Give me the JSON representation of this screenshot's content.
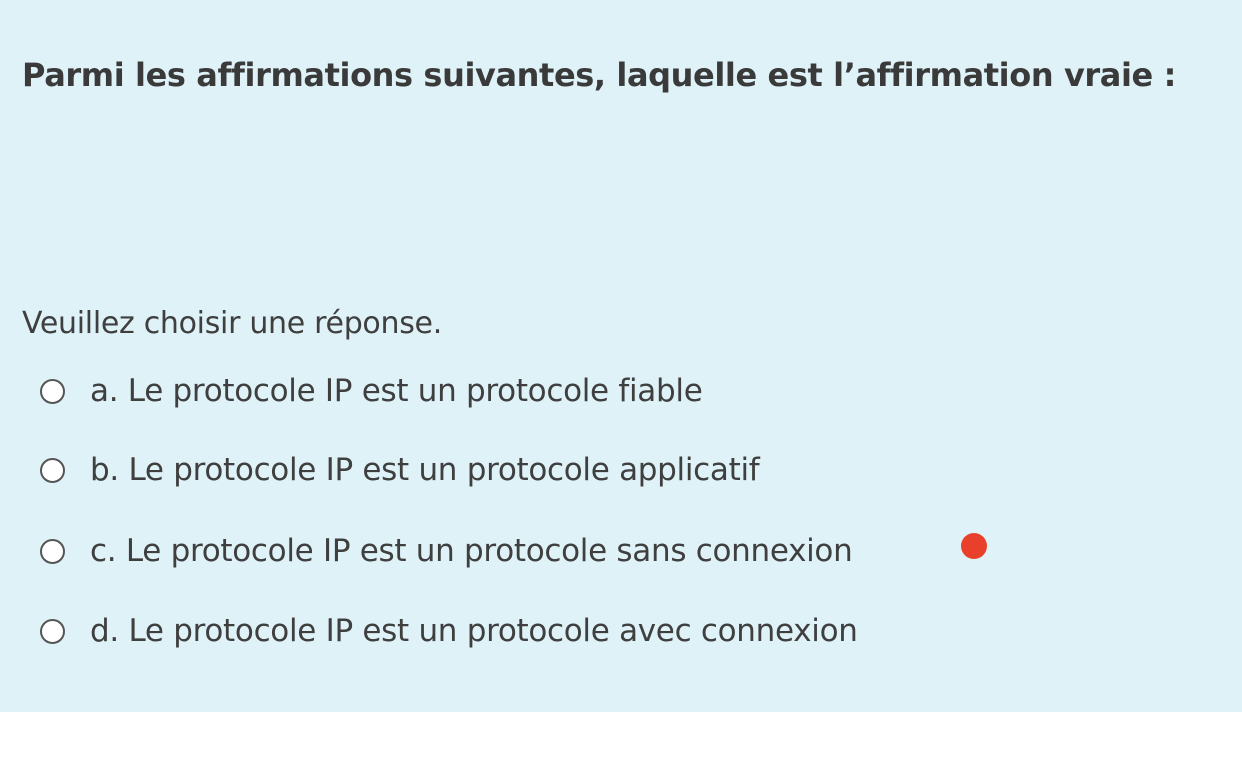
{
  "question": {
    "text": "Parmi les affirmations suivantes, laquelle est l’affirmation vraie :"
  },
  "prompt": "Veuillez choisir une réponse.",
  "options": [
    {
      "label": "a. Le protocole IP est un protocole fiable",
      "selected": false
    },
    {
      "label": "b. Le protocole IP est un protocole applicatif",
      "selected": false
    },
    {
      "label": "c. Le protocole IP est un protocole sans connexion",
      "selected": false
    },
    {
      "label": "d. Le protocole IP est un protocole avec connexion",
      "selected": false
    }
  ],
  "colors": {
    "panel_background": "#def2f8",
    "marker": "#e8402a"
  },
  "marker": {
    "icon": "red-dot-icon",
    "option_index": 2
  }
}
